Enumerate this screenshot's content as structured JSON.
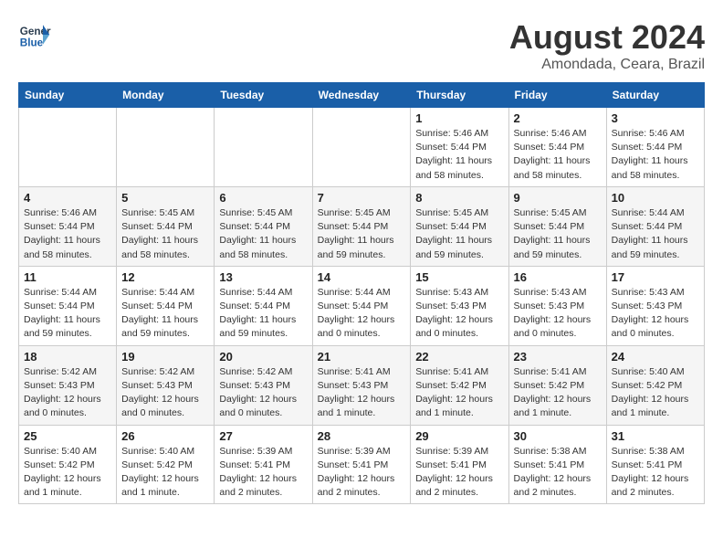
{
  "header": {
    "logo_line1": "General",
    "logo_line2": "Blue",
    "month_title": "August 2024",
    "subtitle": "Amondada, Ceara, Brazil"
  },
  "weekdays": [
    "Sunday",
    "Monday",
    "Tuesday",
    "Wednesday",
    "Thursday",
    "Friday",
    "Saturday"
  ],
  "weeks": [
    [
      {
        "num": "",
        "info": ""
      },
      {
        "num": "",
        "info": ""
      },
      {
        "num": "",
        "info": ""
      },
      {
        "num": "",
        "info": ""
      },
      {
        "num": "1",
        "info": "Sunrise: 5:46 AM\nSunset: 5:44 PM\nDaylight: 11 hours\nand 58 minutes."
      },
      {
        "num": "2",
        "info": "Sunrise: 5:46 AM\nSunset: 5:44 PM\nDaylight: 11 hours\nand 58 minutes."
      },
      {
        "num": "3",
        "info": "Sunrise: 5:46 AM\nSunset: 5:44 PM\nDaylight: 11 hours\nand 58 minutes."
      }
    ],
    [
      {
        "num": "4",
        "info": "Sunrise: 5:46 AM\nSunset: 5:44 PM\nDaylight: 11 hours\nand 58 minutes."
      },
      {
        "num": "5",
        "info": "Sunrise: 5:45 AM\nSunset: 5:44 PM\nDaylight: 11 hours\nand 58 minutes."
      },
      {
        "num": "6",
        "info": "Sunrise: 5:45 AM\nSunset: 5:44 PM\nDaylight: 11 hours\nand 58 minutes."
      },
      {
        "num": "7",
        "info": "Sunrise: 5:45 AM\nSunset: 5:44 PM\nDaylight: 11 hours\nand 59 minutes."
      },
      {
        "num": "8",
        "info": "Sunrise: 5:45 AM\nSunset: 5:44 PM\nDaylight: 11 hours\nand 59 minutes."
      },
      {
        "num": "9",
        "info": "Sunrise: 5:45 AM\nSunset: 5:44 PM\nDaylight: 11 hours\nand 59 minutes."
      },
      {
        "num": "10",
        "info": "Sunrise: 5:44 AM\nSunset: 5:44 PM\nDaylight: 11 hours\nand 59 minutes."
      }
    ],
    [
      {
        "num": "11",
        "info": "Sunrise: 5:44 AM\nSunset: 5:44 PM\nDaylight: 11 hours\nand 59 minutes."
      },
      {
        "num": "12",
        "info": "Sunrise: 5:44 AM\nSunset: 5:44 PM\nDaylight: 11 hours\nand 59 minutes."
      },
      {
        "num": "13",
        "info": "Sunrise: 5:44 AM\nSunset: 5:44 PM\nDaylight: 11 hours\nand 59 minutes."
      },
      {
        "num": "14",
        "info": "Sunrise: 5:44 AM\nSunset: 5:44 PM\nDaylight: 12 hours\nand 0 minutes."
      },
      {
        "num": "15",
        "info": "Sunrise: 5:43 AM\nSunset: 5:43 PM\nDaylight: 12 hours\nand 0 minutes."
      },
      {
        "num": "16",
        "info": "Sunrise: 5:43 AM\nSunset: 5:43 PM\nDaylight: 12 hours\nand 0 minutes."
      },
      {
        "num": "17",
        "info": "Sunrise: 5:43 AM\nSunset: 5:43 PM\nDaylight: 12 hours\nand 0 minutes."
      }
    ],
    [
      {
        "num": "18",
        "info": "Sunrise: 5:42 AM\nSunset: 5:43 PM\nDaylight: 12 hours\nand 0 minutes."
      },
      {
        "num": "19",
        "info": "Sunrise: 5:42 AM\nSunset: 5:43 PM\nDaylight: 12 hours\nand 0 minutes."
      },
      {
        "num": "20",
        "info": "Sunrise: 5:42 AM\nSunset: 5:43 PM\nDaylight: 12 hours\nand 0 minutes."
      },
      {
        "num": "21",
        "info": "Sunrise: 5:41 AM\nSunset: 5:43 PM\nDaylight: 12 hours\nand 1 minute."
      },
      {
        "num": "22",
        "info": "Sunrise: 5:41 AM\nSunset: 5:42 PM\nDaylight: 12 hours\nand 1 minute."
      },
      {
        "num": "23",
        "info": "Sunrise: 5:41 AM\nSunset: 5:42 PM\nDaylight: 12 hours\nand 1 minute."
      },
      {
        "num": "24",
        "info": "Sunrise: 5:40 AM\nSunset: 5:42 PM\nDaylight: 12 hours\nand 1 minute."
      }
    ],
    [
      {
        "num": "25",
        "info": "Sunrise: 5:40 AM\nSunset: 5:42 PM\nDaylight: 12 hours\nand 1 minute."
      },
      {
        "num": "26",
        "info": "Sunrise: 5:40 AM\nSunset: 5:42 PM\nDaylight: 12 hours\nand 1 minute."
      },
      {
        "num": "27",
        "info": "Sunrise: 5:39 AM\nSunset: 5:41 PM\nDaylight: 12 hours\nand 2 minutes."
      },
      {
        "num": "28",
        "info": "Sunrise: 5:39 AM\nSunset: 5:41 PM\nDaylight: 12 hours\nand 2 minutes."
      },
      {
        "num": "29",
        "info": "Sunrise: 5:39 AM\nSunset: 5:41 PM\nDaylight: 12 hours\nand 2 minutes."
      },
      {
        "num": "30",
        "info": "Sunrise: 5:38 AM\nSunset: 5:41 PM\nDaylight: 12 hours\nand 2 minutes."
      },
      {
        "num": "31",
        "info": "Sunrise: 5:38 AM\nSunset: 5:41 PM\nDaylight: 12 hours\nand 2 minutes."
      }
    ]
  ]
}
